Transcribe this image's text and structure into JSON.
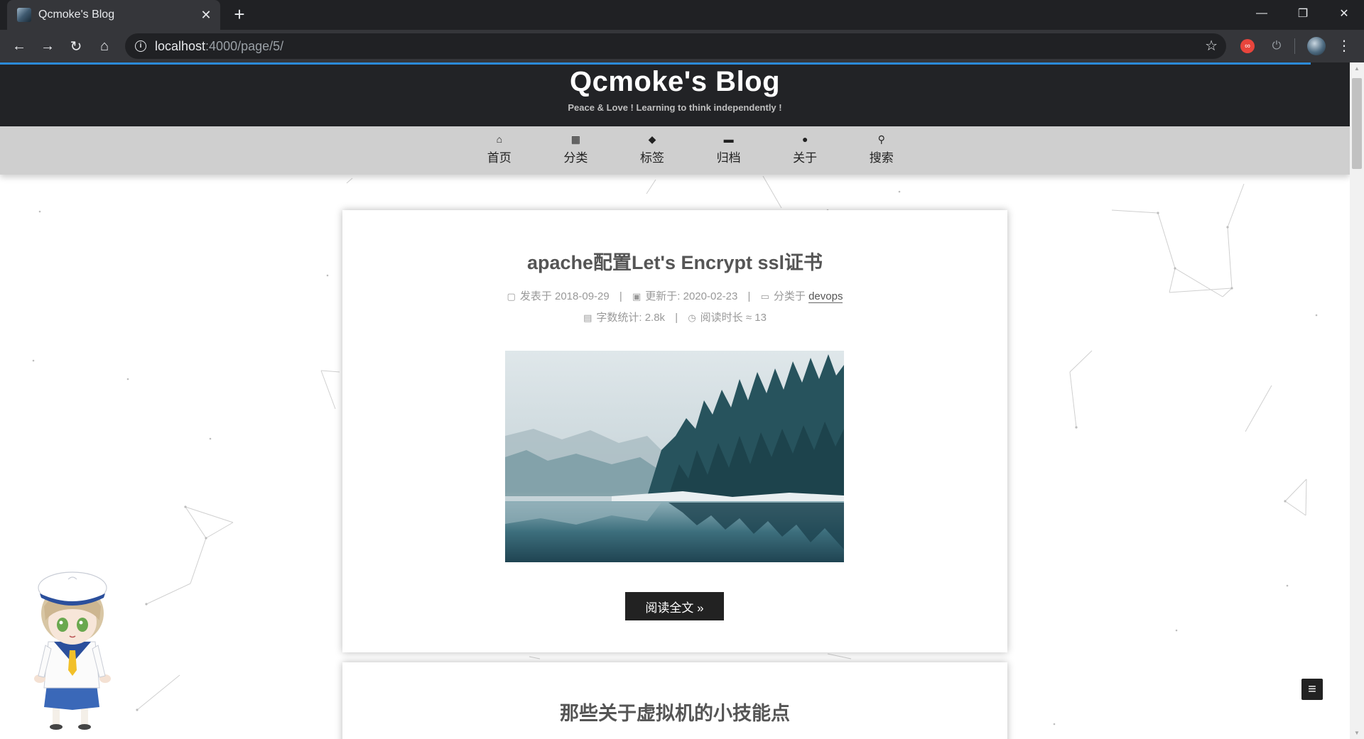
{
  "browser": {
    "tab": {
      "title": "Qcmoke's Blog",
      "close_icon": "close-icon"
    },
    "new_tab_icon": "plus-icon",
    "window_controls": {
      "minimize": "—",
      "restore": "❐",
      "close": "✕"
    },
    "address": {
      "host": "localhost",
      "rest": ":4000/page/5/"
    }
  },
  "site": {
    "title": "Qcmoke's Blog",
    "subtitle": "Peace & Love ! Learning to think independently !"
  },
  "nav": {
    "items": [
      {
        "label": "首页",
        "icon": "home-icon",
        "glyph": "⌂"
      },
      {
        "label": "分类",
        "icon": "grid-icon",
        "glyph": "▦"
      },
      {
        "label": "标签",
        "icon": "tags-icon",
        "glyph": "◆"
      },
      {
        "label": "归档",
        "icon": "archive-icon",
        "glyph": "▬"
      },
      {
        "label": "关于",
        "icon": "user-icon",
        "glyph": "●"
      },
      {
        "label": "搜索",
        "icon": "search-icon",
        "glyph": "⚲"
      }
    ]
  },
  "posts": [
    {
      "title": "apache配置Let's Encrypt ssl证书",
      "posted_label": "发表于",
      "posted_date": "2018-09-29",
      "updated_label": "更新于:",
      "updated_date": "2020-02-23",
      "category_label": "分类于",
      "category": "devops",
      "wordcount_label": "字数统计:",
      "wordcount": "2.8k",
      "readtime_label": "阅读时长 ≈",
      "readtime": "13",
      "read_more": "阅读全文 »"
    },
    {
      "title": "那些关于虚拟机的小技能点"
    }
  ],
  "colors": {
    "header_bg": "#222326",
    "nav_bg": "#cfcfcf",
    "accent_progress": "#2b8ad8",
    "button_bg": "#222222"
  }
}
